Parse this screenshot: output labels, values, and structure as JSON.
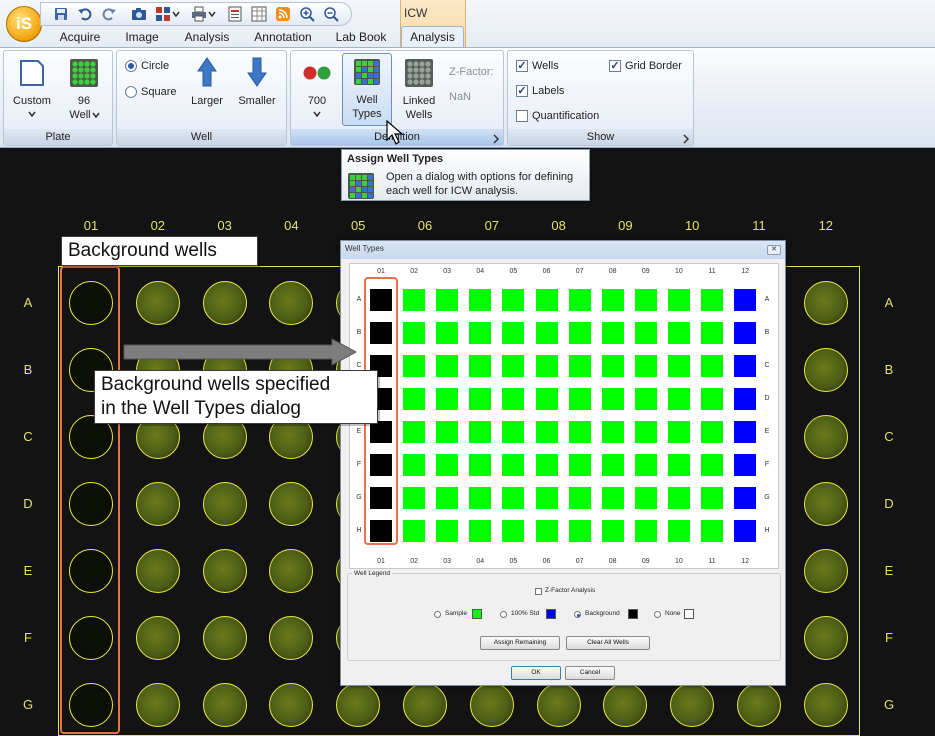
{
  "app": {
    "orb_label": "iS"
  },
  "contextual_tab": {
    "group_label": "ICW"
  },
  "tabs": [
    "Acquire",
    "Image",
    "Analysis",
    "Annotation",
    "Lab Book",
    "Analysis"
  ],
  "ribbon": {
    "plate": {
      "custom_label": "Custom",
      "well_count": "96",
      "well_label": "Well",
      "group_label": "Plate"
    },
    "well": {
      "circle_label": "Circle",
      "square_label": "Square",
      "larger_label": "Larger",
      "smaller_label": "Smaller",
      "group_label": "Well"
    },
    "definition": {
      "channel_label": "700",
      "well_types_line1": "Well",
      "well_types_line2": "Types",
      "linked_line1": "Linked",
      "linked_line2": "Wells",
      "zfactor_label": "Z-Factor:",
      "zfactor_value": "NaN",
      "group_label": "Definition"
    },
    "show": {
      "wells_label": "Wells",
      "grid_border_label": "Grid Border",
      "labels_label": "Labels",
      "quantification_label": "Quantification",
      "group_label": "Show",
      "wells_checked": true,
      "grid_border_checked": true,
      "labels_checked": true,
      "quantification_checked": false
    }
  },
  "tooltip": {
    "title": "Assign Well Types",
    "line1": "Open a dialog with options for defining",
    "line2": "each well for ICW analysis."
  },
  "plate": {
    "columns": [
      "01",
      "02",
      "03",
      "04",
      "05",
      "06",
      "07",
      "08",
      "09",
      "10",
      "11",
      "12"
    ],
    "rows": [
      "A",
      "B",
      "C",
      "D",
      "E",
      "F",
      "G"
    ],
    "border_color": "#e6e34a"
  },
  "callouts": {
    "background_wells": "Background wells",
    "specified_line1": "Background wells specified",
    "specified_line2": "in the Well Types dialog"
  },
  "dialog": {
    "title": "Well Types",
    "close_glyph": "✕",
    "columns": [
      "01",
      "02",
      "03",
      "04",
      "05",
      "06",
      "07",
      "08",
      "09",
      "10",
      "11",
      "12"
    ],
    "rows": [
      "A",
      "B",
      "C",
      "D",
      "E",
      "F",
      "G",
      "H"
    ],
    "column_types": [
      "background",
      "sample",
      "sample",
      "sample",
      "sample",
      "sample",
      "sample",
      "sample",
      "sample",
      "sample",
      "sample",
      "std100"
    ],
    "legend_title": "Well Legend",
    "zfactor_analysis_label": "Z-Factor Analysis",
    "legend_items": [
      {
        "label": "Sample",
        "color": "#00ff00",
        "selected": false
      },
      {
        "label": "100% Std",
        "color": "#0000ff",
        "selected": false
      },
      {
        "label": "Background",
        "color": "#000000",
        "selected": true
      },
      {
        "label": "None",
        "color": "#ffffff",
        "selected": false
      }
    ],
    "assign_remaining_label": "Assign Remaining",
    "clear_all_label": "Clear All Wells",
    "ok_label": "OK",
    "cancel_label": "Cancel"
  },
  "colors": {
    "sample": "#00ff00",
    "std100": "#0000ff",
    "background": "#000000",
    "highlight": "#e8704a",
    "label": "#e3e06a"
  }
}
